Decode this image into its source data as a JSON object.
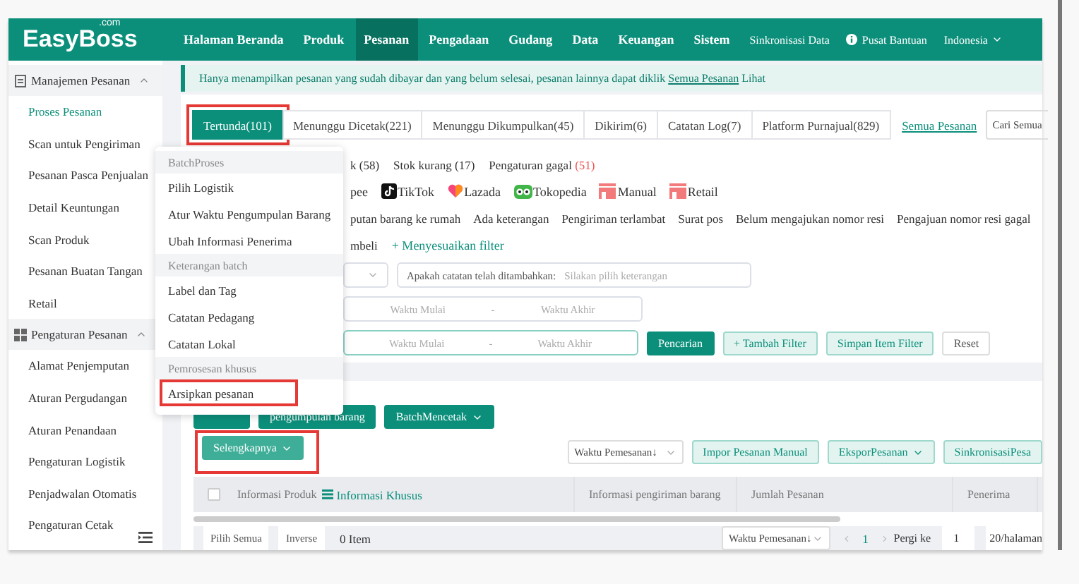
{
  "header": {
    "logo": "EasyBoss",
    "logo_sup": ".com",
    "nav": [
      {
        "label": "Halaman Beranda",
        "selected": false
      },
      {
        "label": "Produk",
        "selected": false
      },
      {
        "label": "Pesanan",
        "selected": true
      },
      {
        "label": "Pengadaan",
        "selected": false
      },
      {
        "label": "Gudang",
        "selected": false
      },
      {
        "label": "Data",
        "selected": false
      },
      {
        "label": "Keuangan",
        "selected": false
      },
      {
        "label": "Sistem",
        "selected": false
      }
    ],
    "sync": "Sinkronisasi Data",
    "help": "Pusat Bantuan",
    "language": "Indonesia"
  },
  "sidebar": {
    "groups": [
      {
        "title": "Manajemen Pesanan",
        "kind": "orders",
        "expanded": true,
        "items": [
          {
            "label": "Proses Pesanan",
            "selected": true
          },
          {
            "label": "Scan untuk Pengiriman",
            "selected": false
          },
          {
            "label": "Pesanan Pasca Penjualan",
            "selected": false
          },
          {
            "label": "Detail Keuntungan",
            "selected": false
          },
          {
            "label": "Scan Produk",
            "selected": false
          },
          {
            "label": "Pesanan Buatan Tangan",
            "selected": false
          },
          {
            "label": "Retail",
            "selected": false
          }
        ]
      },
      {
        "title": "Pengaturan Pesanan",
        "kind": "settings",
        "expanded": true,
        "items": [
          {
            "label": "Alamat Penjemputan",
            "selected": false
          },
          {
            "label": "Aturan Pergudangan",
            "selected": false
          },
          {
            "label": "Aturan Penandaan",
            "selected": false
          },
          {
            "label": "Pengaturan Logistik",
            "selected": false
          },
          {
            "label": "Penjadwalan Otomatis",
            "selected": false
          },
          {
            "label": "Pengaturan Cetak",
            "selected": false
          }
        ]
      }
    ]
  },
  "notice": {
    "text": "Hanya menampilkan pesanan yang sudah dibayar dan yang belum selesai, pesanan lainnya dapat diklik ",
    "link": "Semua Pesanan",
    "tail": " Lihat"
  },
  "tabs": [
    {
      "label": "Tertunda(101)",
      "selected": true,
      "highlighted": true
    },
    {
      "label": "Menunggu Dicetak(221)",
      "selected": false,
      "highlighted": false
    },
    {
      "label": "Menunggu Dikumpulkan(45)",
      "selected": false,
      "highlighted": false
    },
    {
      "label": "Dikirim(6)",
      "selected": false,
      "highlighted": false
    },
    {
      "label": "Catatan Log(7)",
      "selected": false,
      "highlighted": false
    },
    {
      "label": "Platform Purnajual(829)",
      "selected": false,
      "highlighted": false
    }
  ],
  "all_orders_link": "Semua Pesanan",
  "search": {
    "placeholder": "Cari Semua"
  },
  "status_filters": [
    {
      "label": "k (58)"
    },
    {
      "label": "Stok kurang (17)"
    },
    {
      "label": "Pengaturan gagal",
      "count": "(51)"
    }
  ],
  "platforms": [
    {
      "label": "pee",
      "kind": "text"
    },
    {
      "label": "TikTok",
      "kind": "tiktok"
    },
    {
      "label": "Lazada",
      "kind": "lazada"
    },
    {
      "label": "Tokopedia",
      "kind": "tokopedia"
    },
    {
      "label": "Manual",
      "kind": "box"
    },
    {
      "label": "Retail",
      "kind": "box"
    }
  ],
  "tags": [
    "putan barang ke rumah",
    "Ada keterangan",
    "Pengiriman terlambat",
    "Surat pos",
    "Belum mengajukan nomor resi",
    "Pengajuan nomor resi gagal"
  ],
  "buyer_row": {
    "label": "mbeli",
    "link": "+ Menyesuaikan filter"
  },
  "note_field": {
    "label": "Apakah catatan telah ditambahkan:",
    "placeholder": "Silakan pilih keterangan"
  },
  "date_ranges": [
    {
      "start": "Waktu Mulai",
      "separator": "-",
      "end": "Waktu Akhir",
      "focused": false
    },
    {
      "start": "Waktu Mulai",
      "separator": "-",
      "end": "Waktu Akhir",
      "focused": true
    }
  ],
  "filter_buttons": [
    {
      "label": "Pencarian",
      "kind": "primary"
    },
    {
      "label": "+ Tambah Filter",
      "kind": "soft"
    },
    {
      "label": "Simpan Item Filter",
      "kind": "soft"
    },
    {
      "label": "Reset",
      "kind": "plain"
    }
  ],
  "actions": [
    {
      "kind": "covered"
    },
    {
      "label": "pengumpulan barang",
      "kind": "primary"
    },
    {
      "label": "BatchMencetak",
      "kind": "dropdown"
    }
  ],
  "more_button": {
    "label": "Selengkapnya",
    "highlighted": true
  },
  "sort_select": "Waktu Pemesanan↓",
  "right_actions": [
    {
      "label": "Impor Pesanan Manual",
      "kind": "soft"
    },
    {
      "label": "EksporPesanan",
      "kind": "dropdown"
    },
    {
      "label": "SinkronisasiPesa",
      "kind": "soft"
    }
  ],
  "table": {
    "select_all_checked": false,
    "columns": [
      "Informasi Produk",
      "Informasi Khusus",
      "Informasi pengiriman barang",
      "Jumlah Pesanan",
      "Penerima"
    ]
  },
  "footer": {
    "select_all": "Pilih Semua",
    "inverse": "Inverse",
    "count": "0 Item",
    "sort_select": "Waktu Pemesanan↓",
    "page": "1",
    "goto_label": "Pergi ke",
    "goto_value": "1",
    "page_size": "20/halaman"
  },
  "dropdown": {
    "sections": [
      {
        "title": "BatchProses",
        "items": [
          {
            "label": "Pilih Logistik",
            "highlighted": false
          },
          {
            "label": "Atur Waktu Pengumpulan Barang",
            "highlighted": false
          },
          {
            "label": "Ubah Informasi Penerima",
            "highlighted": false
          }
        ]
      },
      {
        "title": "Keterangan batch",
        "items": [
          {
            "label": "Label dan Tag",
            "highlighted": false
          },
          {
            "label": "Catatan Pedagang",
            "highlighted": false
          },
          {
            "label": "Catatan Lokal",
            "highlighted": false
          }
        ]
      },
      {
        "title": "Pemrosesan khusus",
        "items": [
          {
            "label": "Arsipkan pesanan",
            "highlighted": true
          }
        ]
      }
    ]
  }
}
